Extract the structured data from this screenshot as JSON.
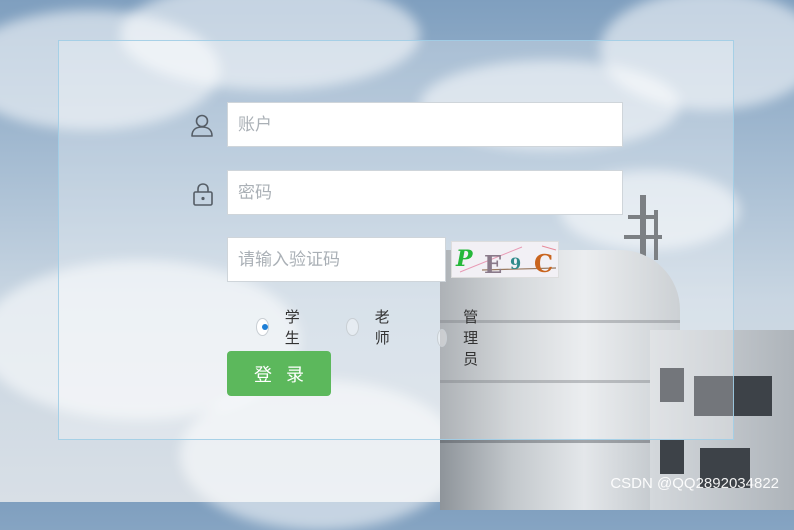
{
  "login": {
    "account": {
      "placeholder": "账户",
      "value": ""
    },
    "password": {
      "placeholder": "密码",
      "value": ""
    },
    "captcha_input": {
      "placeholder": "请输入验证码",
      "value": ""
    },
    "captcha_chars": [
      "P",
      "E",
      "9",
      "C"
    ],
    "roles": [
      {
        "label": "学生",
        "checked": true
      },
      {
        "label": "老师",
        "checked": false
      },
      {
        "label": "管理员",
        "checked": false
      }
    ],
    "submit_label": "登录"
  },
  "watermark": "CSDN @QQ2892034822",
  "colors": {
    "button": "#5cb85c",
    "radio_selected": "#1e7fd6",
    "panel_border": "#a0cde6"
  },
  "icons": [
    "user-icon",
    "lock-icon"
  ]
}
